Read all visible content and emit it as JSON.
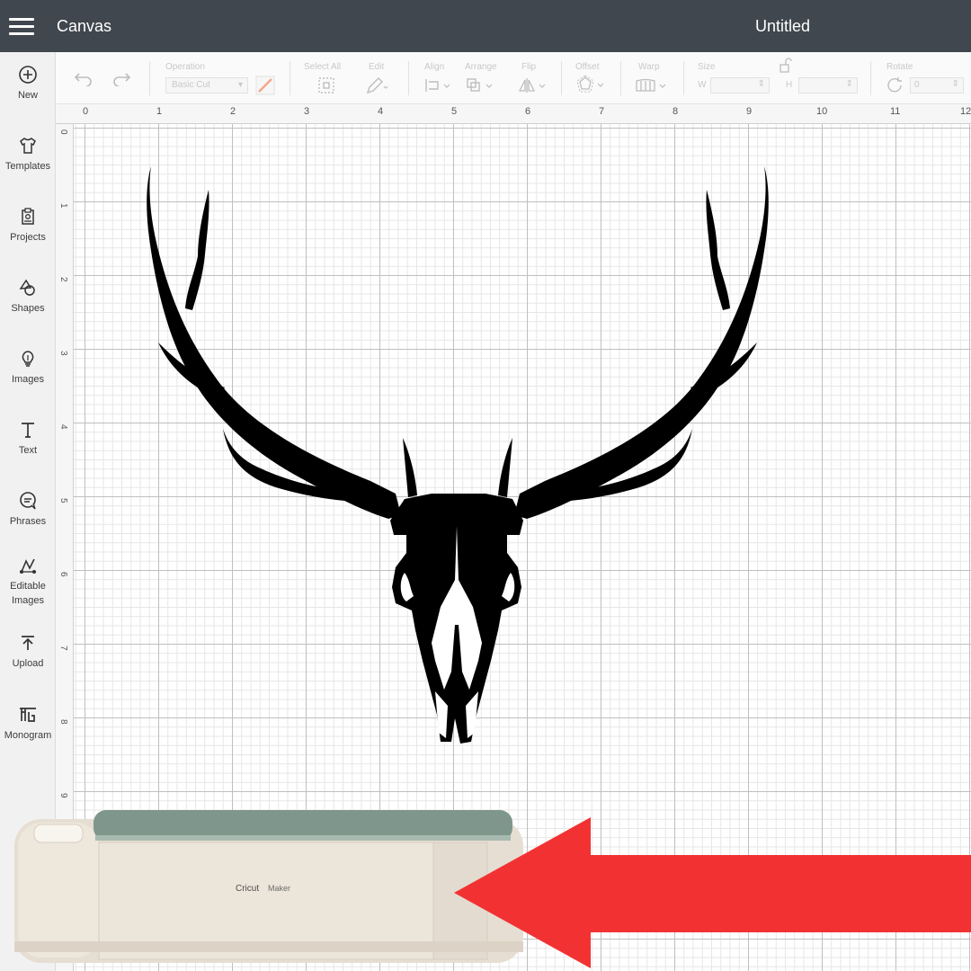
{
  "topbar": {
    "app_title": "Canvas",
    "doc_title": "Untitled",
    "bg_color": "#40474e"
  },
  "sidebar": {
    "items": [
      {
        "label": "New",
        "icon": "plus-circle-icon"
      },
      {
        "label": "Templates",
        "icon": "tshirt-icon"
      },
      {
        "label": "Projects",
        "icon": "project-icon"
      },
      {
        "label": "Shapes",
        "icon": "shapes-icon"
      },
      {
        "label": "Images",
        "icon": "lightbulb-icon"
      },
      {
        "label": "Text",
        "icon": "text-icon"
      },
      {
        "label": "Phrases",
        "icon": "speech-bubble-icon"
      },
      {
        "label": "Editable",
        "label2": "Images",
        "icon": "editable-images-icon"
      },
      {
        "label": "Upload",
        "icon": "upload-icon"
      },
      {
        "label": "Monogram",
        "icon": "monogram-icon"
      }
    ]
  },
  "toolbar": {
    "operation_label": "Operation",
    "operation_value": "Basic Cut",
    "select_all_label": "Select All",
    "edit_label": "Edit",
    "align_label": "Align",
    "arrange_label": "Arrange",
    "flip_label": "Flip",
    "offset_label": "Offset",
    "warp_label": "Warp",
    "size_label": "Size",
    "size_w": "W",
    "size_h": "H",
    "rotate_label": "Rotate",
    "rotate_value": "0"
  },
  "ruler": {
    "top": [
      "0",
      "1",
      "2",
      "3",
      "4",
      "5",
      "6",
      "7",
      "8",
      "9",
      "10",
      "11",
      "12"
    ],
    "left": [
      "0",
      "1",
      "2",
      "3",
      "4",
      "5",
      "6",
      "7",
      "8",
      "9"
    ]
  },
  "machine": {
    "brand": "Cricut",
    "model": "Maker"
  },
  "colors": {
    "arrow": "#f23232",
    "artwork": "#000000"
  }
}
